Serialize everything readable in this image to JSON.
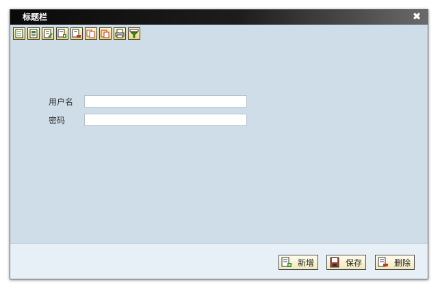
{
  "window": {
    "title": "标题栏"
  },
  "toolbar": {
    "buttons": [
      {
        "icon": "document-icon"
      },
      {
        "icon": "document-view-icon"
      },
      {
        "icon": "document-edit-icon"
      },
      {
        "icon": "document-add-icon"
      },
      {
        "icon": "document-delete-icon"
      },
      {
        "icon": "copy-icon"
      },
      {
        "icon": "paste-icon"
      },
      {
        "icon": "print-icon"
      },
      {
        "icon": "filter-icon"
      }
    ]
  },
  "form": {
    "username": {
      "label": "用户名",
      "value": "",
      "placeholder": ""
    },
    "password": {
      "label": "密码",
      "value": "",
      "placeholder": ""
    }
  },
  "footer": {
    "add_label": "新增",
    "save_label": "保存",
    "delete_label": "删除"
  },
  "colors": {
    "window_bg": "#cfdde8",
    "footer_bg": "#e8f0f7",
    "button_bg": "#f2e8b8",
    "accent_green": "#2e8b2e",
    "accent_red": "#c0392b"
  }
}
